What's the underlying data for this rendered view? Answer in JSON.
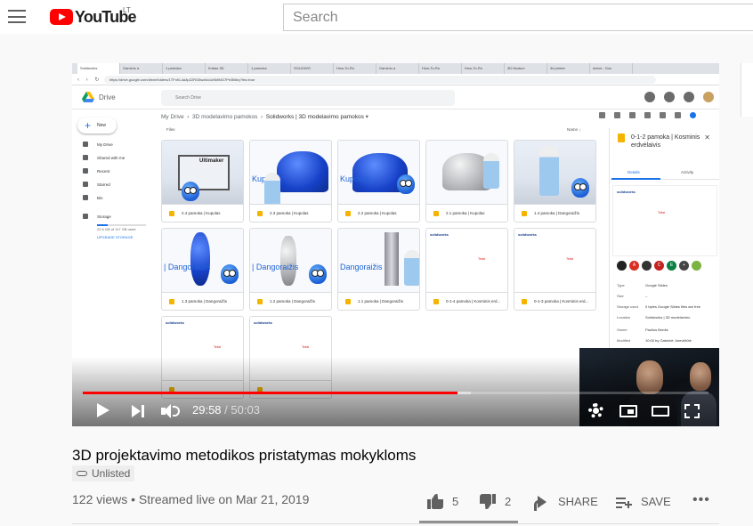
{
  "header": {
    "logo_text": "YouTube",
    "country_code": "LT",
    "search_placeholder": "Search"
  },
  "screen": {
    "browser_tabs": [
      "Solidworks",
      "Gaminiu a",
      "1 pamoka",
      "Kubas 3D",
      "1 pamoka",
      "SOLIDWO",
      "How-To-Ro",
      "Gaminiu a",
      "How-To-Ro",
      "How-To-Ro",
      "3D Modum",
      "3d printer",
      "dobot - Goo"
    ],
    "address": "https://drive.google.com/drive/folders/1TFnKL4a3pZ2RG8wz8o1oNMMG7Pe3BbIq?ths=true",
    "drive_title": "Drive",
    "drive_search": "Search Drive",
    "new_label": "New",
    "sidebar_items": [
      "My Drive",
      "Shared with me",
      "Recent",
      "Starred",
      "Bin"
    ],
    "storage_label": "Storage",
    "storage_used": "22.6 GB of 117 GB used",
    "upgrade_label": "UPGRADE STORAGE",
    "breadcrumb": [
      "My Drive",
      "3D modelavimo pamokos",
      "Solidworks | 3D modelavimo pamokos"
    ],
    "files_label": "Files",
    "sort_label": "Name",
    "files": [
      {
        "name": "2.4 pamoka | Kupolas",
        "thumb_text": "Ultimaker"
      },
      {
        "name": "2.3 pamoka | Kupolas",
        "thumb_text": "Kupolas"
      },
      {
        "name": "2.2 pamoka | Kupolas",
        "thumb_text": "Kupolas"
      },
      {
        "name": "2.1 pamoka | Kupolas",
        "thumb_text": ""
      },
      {
        "name": "1.4 pamoka | Dangoraižis",
        "thumb_text": ""
      },
      {
        "name": "1.3 pamoka | Dangoraižis",
        "thumb_text": "| Dangoraižis"
      },
      {
        "name": "1.2 pamoka | Dangoraižis",
        "thumb_text": "| Dangoraižis"
      },
      {
        "name": "1.1 pamoka | Dangoraižis",
        "thumb_text": "Dangoraižis"
      },
      {
        "name": "0-1-4 pamoka | Kosminis erd...",
        "thumb_text": ""
      },
      {
        "name": "0-1-3 pamoka | Kosminis erd...",
        "thumb_text": ""
      },
      {
        "name": "",
        "thumb_text": ""
      },
      {
        "name": "",
        "thumb_text": ""
      }
    ],
    "details": {
      "title": "0-1-2 pamoka | Kosminis erdvėlaivis",
      "tab_details": "Details",
      "tab_activity": "Activity",
      "avatars": [
        "A",
        "C",
        "E",
        "+"
      ],
      "avatar_colors": [
        "#222222",
        "#d93025",
        "#333333",
        "#c5221f",
        "#0b8043",
        "#444444",
        "#7cb342"
      ],
      "rows": [
        {
          "k": "Type",
          "v": "Google Slides"
        },
        {
          "k": "Size",
          "v": "–"
        },
        {
          "k": "Storage used",
          "v": "0 bytes  Google Slides files are free"
        },
        {
          "k": "Location",
          "v": "Solidworks | 3D modelavimo"
        },
        {
          "k": "Owner",
          "v": "Paulius Bredis"
        },
        {
          "k": "Modified",
          "v": "10:00 by Gabrielė Jurevičiūtė"
        }
      ]
    }
  },
  "player": {
    "current_time": "29:58",
    "separator": " / ",
    "duration": "50:03",
    "progress_fraction": 0.5987
  },
  "video": {
    "title": "3D projektavimo metodikos pristatymas mokykloms",
    "visibility": "Unlisted",
    "views_line": "122 views • Streamed live on Mar 21, 2019",
    "likes": "5",
    "dislikes": "2",
    "share_label": "SHARE",
    "save_label": "SAVE",
    "more_label": "•••"
  },
  "colors": {
    "brand_red": "#ff0000",
    "drive_blue": "#1a73e8",
    "slides_yellow": "#f4b400"
  }
}
